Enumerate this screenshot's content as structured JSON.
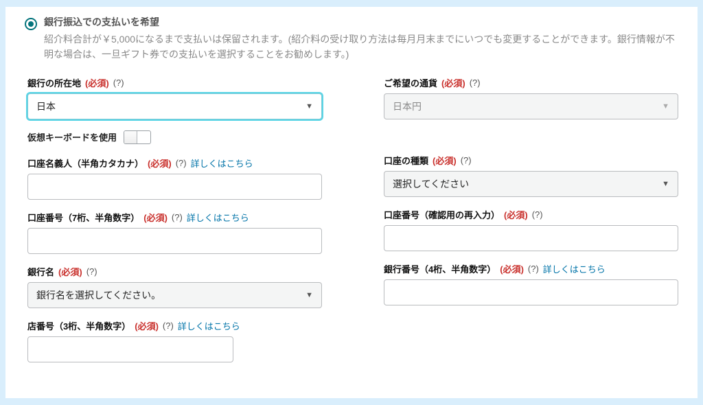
{
  "option": {
    "title": "銀行振込での支払いを希望",
    "desc": "紹介料合計が￥5,000になるまで支払いは保留されます。(紹介料の受け取り方法は毎月月末までにいつでも変更することができます。銀行情報が不明な場合は、一旦ギフト券での支払いを選択することをお勧めします。)"
  },
  "labels": {
    "bankLocation": "銀行の所在地",
    "currency": "ご希望の通貨",
    "virtualKeyboard": "仮想キーボードを使用",
    "accountHolder": "口座名義人（半角カタカナ）",
    "accountType": "口座の種類",
    "accountNumber": "口座番号（7桁、半角数字）",
    "accountNumberConfirm": "口座番号（確認用の再入力）",
    "bankName": "銀行名",
    "bankCode": "銀行番号（4桁、半角数字）",
    "branchCode": "店番号（3桁、半角数字）",
    "required": "(必須)",
    "help": "(?)",
    "details": "詳しくはこちら"
  },
  "values": {
    "bankLocation": "日本",
    "currency": "日本円",
    "accountTypePlaceholder": "選択してください",
    "bankNamePlaceholder": "銀行名を選択してください。"
  }
}
